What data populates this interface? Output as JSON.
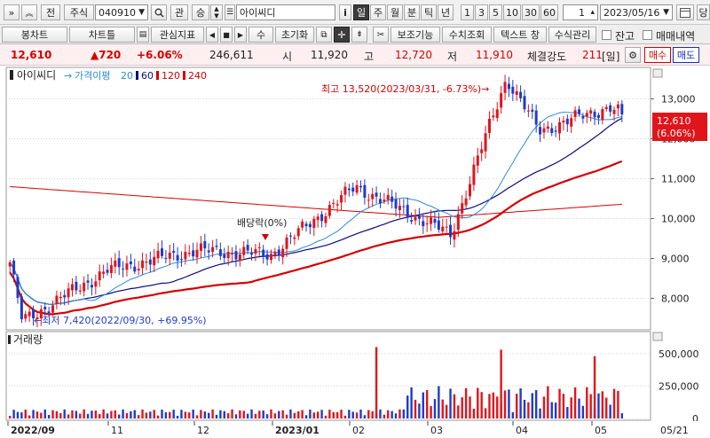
{
  "toolbar1": {
    "nav_double_right": "»",
    "nav_double_up": "«",
    "btn_full": "전",
    "market_select": "주식",
    "code": "040910",
    "btn_interest": "관",
    "btn_rank": "승",
    "stock_name": "아이씨디",
    "btn_info": "i",
    "periods": [
      "일",
      "주",
      "월",
      "분",
      "틱",
      "년"
    ],
    "period_selected": "일",
    "intervals": [
      "1",
      "3",
      "5",
      "10",
      "30",
      "60"
    ],
    "count_value": "1",
    "date": "2023/05/16",
    "btn_today": "당"
  },
  "toolbar2": {
    "btn_bongchart": "봉차트",
    "btn_chart_tool": "차트틀",
    "btn_indicator": "관심지표",
    "btn_manual": "수",
    "btn_reset": "초기화",
    "btn_assist": "보조기능",
    "btn_sum": "수치조회",
    "btn_text": "텍스트 창",
    "btn_formula": "수식관리",
    "chk_balance": "잔고",
    "chk_trade": "매매내역"
  },
  "pricebar": {
    "price": "12,610",
    "change": "▲720",
    "change_rate": "+6.06%",
    "volume": "246,611",
    "open_label": "시",
    "open": "11,920",
    "high_label": "고",
    "high": "12,720",
    "low_label": "저",
    "low": "11,910",
    "strength_label": "체결강도",
    "strength": "211",
    "strength_unit": "[일]",
    "btn_buy": "매수",
    "btn_sell": "매도"
  },
  "legend": {
    "name": "아이씨디",
    "ma_label": "가격이평",
    "ma_values": [
      "20",
      "60",
      "120",
      "240"
    ],
    "ma_colors": [
      "#2e8bd6",
      "#0a0a80",
      "#d40000",
      "#d40000"
    ]
  },
  "price_panel": {
    "current_label": "12,610",
    "current_rate": "(6.06%)",
    "high_annotation": "최고 13,520(2023/03/31, -6.73%)→",
    "low_annotation": "←최저 7,420(2022/09/30, +69.95%)",
    "dividend_annotation": "배당락(0%)",
    "y_ticks": [
      "13,000",
      "12,000",
      "11,000",
      "10,000",
      "9,000",
      "8,000"
    ]
  },
  "volume_panel": {
    "title": "거래량",
    "y_ticks": [
      "500,000",
      "250,000",
      "0"
    ]
  },
  "x_axis": {
    "labels": [
      "2022/09",
      "11",
      "12",
      "2023/01",
      "02",
      "03",
      "04",
      "05"
    ],
    "right_label": "05/21"
  },
  "colors": {
    "up": "#e0151c",
    "down": "#1e3cc8",
    "ma20": "#2e8bd6",
    "ma60": "#0a0a80",
    "ma120": "#d40000",
    "ma240": "#d40000"
  },
  "chart_data": {
    "type": "candlestick",
    "price_range": [
      7300,
      13700
    ],
    "volume_range": [
      0,
      560000
    ],
    "daily_close_anchors": [
      {
        "date": "2022/09",
        "close": 8900
      },
      {
        "date": "2022/09/30",
        "close": 7420
      },
      {
        "date": "2022/10",
        "close": 7900
      },
      {
        "date": "2022/11",
        "close": 8700
      },
      {
        "date": "2022/12",
        "close": 9200
      },
      {
        "date": "2023/01",
        "close": 9100
      },
      {
        "date": "2023/02",
        "close": 10800
      },
      {
        "date": "2023/03",
        "close": 9600
      },
      {
        "date": "2023/03/31",
        "close": 13520
      },
      {
        "date": "2023/04",
        "close": 12200
      },
      {
        "date": "2023/05",
        "close": 12800
      },
      {
        "date": "2023/05/16",
        "close": 12610
      }
    ],
    "volume_peaks": [
      {
        "date": "2023/02",
        "volume": 550000
      },
      {
        "date": "2023/03/31",
        "volume": 530000
      },
      {
        "date": "2023/05",
        "volume": 480000
      }
    ]
  }
}
